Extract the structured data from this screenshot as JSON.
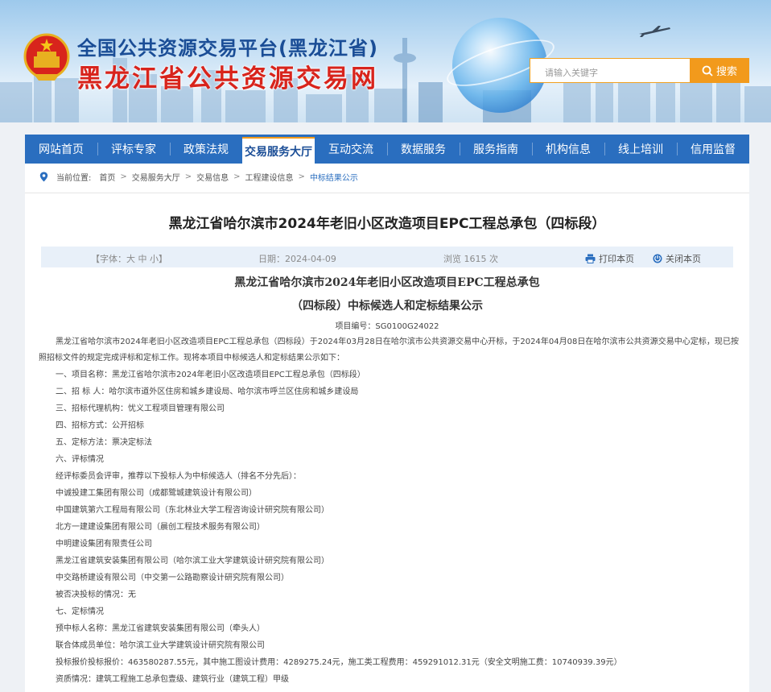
{
  "header": {
    "title_line1": "全国公共资源交易平台(黑龙江省)",
    "title_line2": "黑龙江省公共资源交易网",
    "search_placeholder": "请输入关键字",
    "search_label": "搜索"
  },
  "nav": {
    "items": [
      "网站首页",
      "评标专家",
      "政策法规",
      "交易服务大厅",
      "互动交流",
      "数据服务",
      "服务指南",
      "机构信息",
      "线上培训",
      "信用监督"
    ],
    "active_index": 3
  },
  "breadcrumb": {
    "prefix": "当前位置:",
    "items": [
      "首页",
      "交易服务大厅",
      "交易信息",
      "工程建设信息",
      "中标结果公示"
    ],
    "separator": ">"
  },
  "article": {
    "title": "黑龙江省哈尔滨市2024年老旧小区改造项目EPC工程总承包（四标段）",
    "font_size": "【字体：大 中 小】",
    "date": "日期：2024-04-09",
    "views": "浏览 1615 次",
    "print_label": "打印本页",
    "close_label": "关闭本页"
  },
  "doc": {
    "heading1": "黑龙江省哈尔滨市2024年老旧小区改造项目EPC工程总承包",
    "heading2": "（四标段）中标候选人和定标结果公示",
    "project_no": "项目编号：SG0100G24022",
    "intro": "黑龙江省哈尔滨市2024年老旧小区改造项目EPC工程总承包（四标段）于2024年03月28日在哈尔滨市公共资源交易中心开标，于2024年04月08日在哈尔滨市公共资源交易中心定标，现已按照招标文件的规定完成评标和定标工作。现将本项目中标候选人和定标结果公示如下：",
    "lines": [
      "一、项目名称：黑龙江省哈尔滨市2024年老旧小区改造项目EPC工程总承包（四标段）",
      "二、招 标 人：哈尔滨市道外区住房和城乡建设局、哈尔滨市呼兰区住房和城乡建设局",
      "三、招标代理机构：忧义工程项目管理有限公司",
      "四、招标方式：公开招标",
      "五、定标方法：票决定标法",
      "六、评标情况",
      "经评标委员会评审，推荐以下投标人为中标候选人（排名不分先后）：",
      "中诚投建工集团有限公司（成都鹭城建筑设计有限公司）",
      "中国建筑第六工程局有限公司（东北林业大学工程咨询设计研究院有限公司）",
      "北方一建建设集团有限公司（晨创工程技术服务有限公司）",
      "中明建设集团有限责任公司",
      "黑龙江省建筑安装集团有限公司（哈尔滨工业大学建筑设计研究院有限公司）",
      "中交路桥建设有限公司（中交第一公路勘察设计研究院有限公司）",
      "被否决投标的情况：无",
      "七、定标情况",
      "预中标人名称：黑龙江省建筑安装集团有限公司（牵头人）",
      "联合体成员单位：哈尔滨工业大学建筑设计研究院有限公司",
      "投标报价投标报价：463580287.55元，其中施工图设计费用：4289275.24元，施工类工程费用：459291012.31元（安全文明施工费：10740939.39元）",
      "资质情况：建筑工程施工总承包壹级、建筑行业（建筑工程）甲级"
    ]
  },
  "colors": {
    "nav_bg": "#2a6ebf",
    "title_red": "#d8241c",
    "title_blue": "#1a4d96",
    "search_orange": "#f29a1c"
  }
}
